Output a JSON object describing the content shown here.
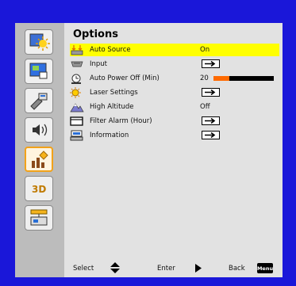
{
  "menu": {
    "title": "Options"
  },
  "sidebar": {
    "items": [
      {
        "name": "image-settings-icon",
        "selected": false
      },
      {
        "name": "screen-icon",
        "selected": false
      },
      {
        "name": "setting-icon",
        "selected": false
      },
      {
        "name": "volume-icon",
        "selected": false
      },
      {
        "name": "options-icon",
        "selected": true
      },
      {
        "name": "3d-icon",
        "label": "3D",
        "selected": false
      },
      {
        "name": "lan-icon",
        "selected": false
      }
    ]
  },
  "options": [
    {
      "label": "Auto Source",
      "value": "On",
      "selected": true
    },
    {
      "label": "Input",
      "control": "enter"
    },
    {
      "label": "Auto Power Off (Min)",
      "value": "20",
      "level": 0.26
    },
    {
      "label": "Laser Settings",
      "control": "enter"
    },
    {
      "label": "High Altitude",
      "value": "Off"
    },
    {
      "label": "Filter Alarm (Hour)",
      "control": "enter"
    },
    {
      "label": "Information",
      "control": "enter"
    }
  ],
  "footer": {
    "select": "Select",
    "enter": "Enter",
    "back": "Back",
    "menu_key": "Menu"
  },
  "colors": {
    "background": "#1a17d9",
    "highlight": "#ffff00",
    "slider_fill": "#ff6a00",
    "selected_border": "#f1a21a"
  }
}
